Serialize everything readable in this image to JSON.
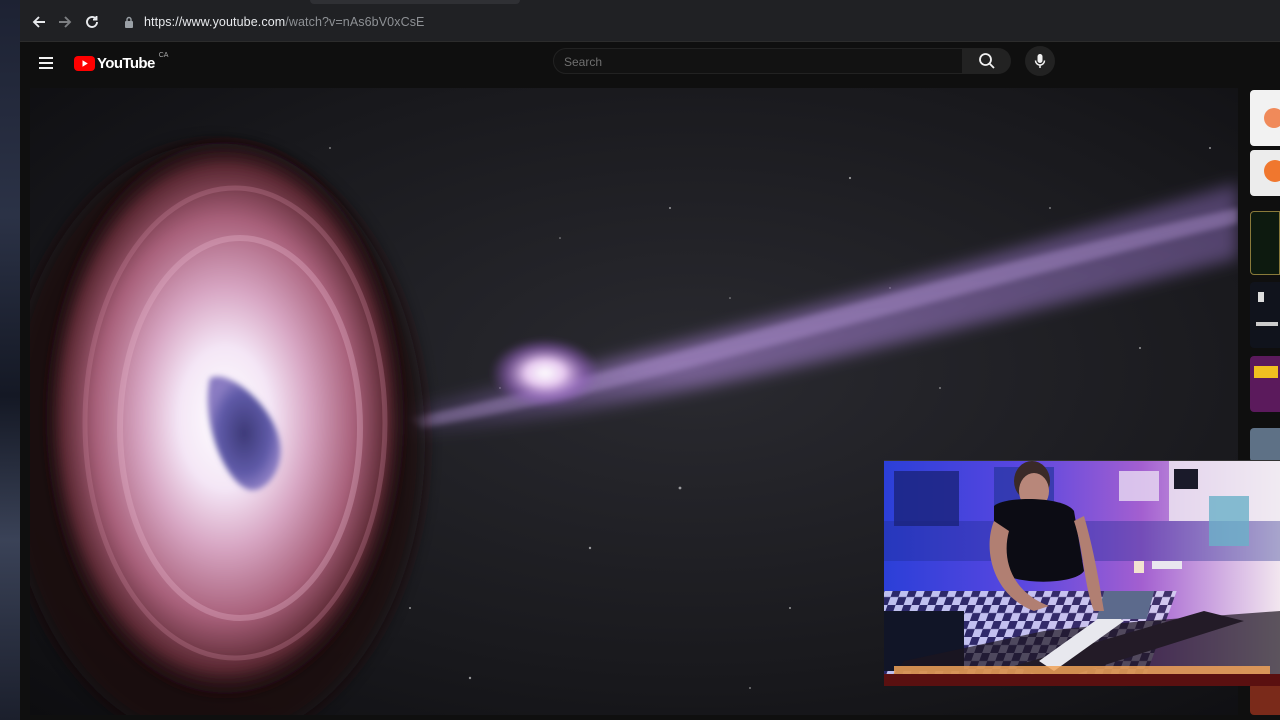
{
  "browser": {
    "url_host": "https://www.youtube.com",
    "url_path": "/watch?v=nAs6bV0xCsE"
  },
  "youtube": {
    "logo_text": "YouTube",
    "country_code": "CA",
    "search": {
      "placeholder": "Search",
      "value": ""
    }
  },
  "colors": {
    "brand_red": "#ff0000",
    "page_background": "#0f0f0f",
    "browser_chrome": "#202124"
  },
  "icons": {
    "back": "back-arrow-icon",
    "forward": "forward-arrow-icon",
    "reload": "reload-icon",
    "lock": "lock-icon",
    "menu": "hamburger-menu-icon",
    "search": "search-icon",
    "mic": "microphone-icon"
  },
  "video": {
    "description_visual": "black-hole-with-relativistic-jet"
  }
}
